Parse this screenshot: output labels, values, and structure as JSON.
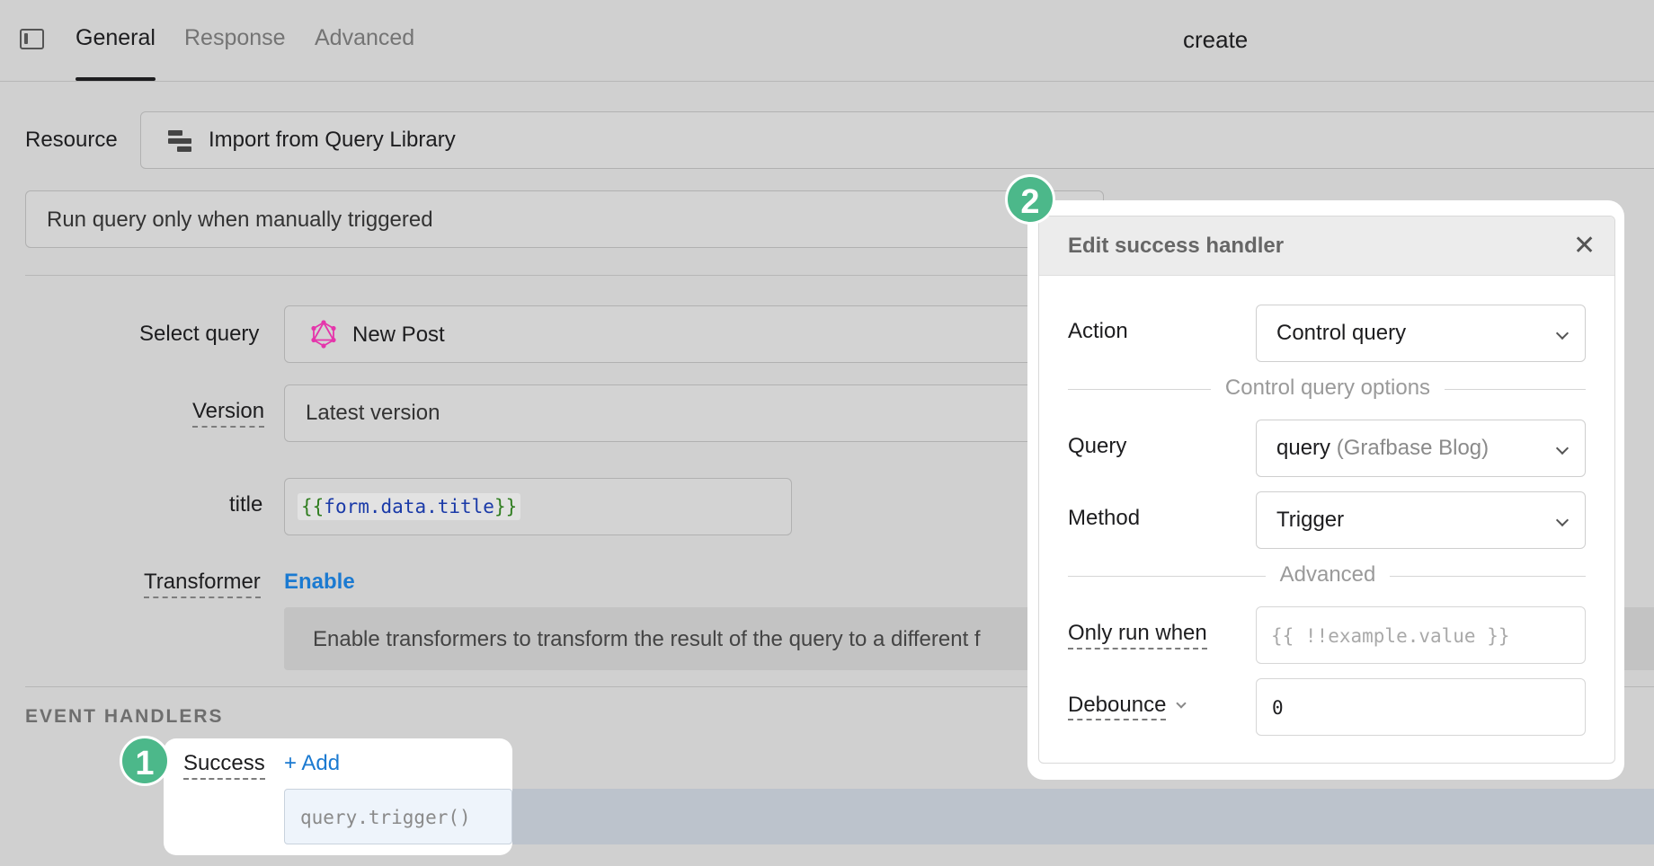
{
  "tabs": [
    {
      "label": "General"
    },
    {
      "label": "Response"
    },
    {
      "label": "Advanced"
    }
  ],
  "page_title": "create",
  "resource": {
    "label": "Resource",
    "value": "Import from Query Library"
  },
  "run_mode": {
    "value": "Run query only when manually triggered"
  },
  "select_query": {
    "label": "Select query",
    "value": "New Post"
  },
  "version": {
    "label": "Version",
    "value": "Latest version"
  },
  "title_field": {
    "label": "title",
    "value": "{{form.data.title}}"
  },
  "transformer": {
    "label": "Transformer",
    "enable_link": "Enable",
    "info": "Enable transformers to transform the result of the query to a different f"
  },
  "event_handlers": {
    "heading": "EVENT HANDLERS",
    "success_label": "Success",
    "add_label": "+ Add",
    "handler_item": "query.trigger()"
  },
  "badges": {
    "one": "1",
    "two": "2"
  },
  "popover": {
    "title": "Edit success handler",
    "action": {
      "label": "Action",
      "value": "Control query"
    },
    "section1": "Control query options",
    "query": {
      "label": "Query",
      "value": "query",
      "sub": "(Grafbase Blog)"
    },
    "method": {
      "label": "Method",
      "value": "Trigger"
    },
    "section2": "Advanced",
    "only_run_when": {
      "label": "Only run when",
      "placeholder": "{{ !!example.value }}"
    },
    "debounce": {
      "label": "Debounce",
      "value": "0"
    }
  },
  "colors": {
    "accent_link": "#1b7ad1",
    "badge": "#4cb88a",
    "code_green": "#2f7d1f",
    "code_blue": "#1a3aa8",
    "graphql_pink": "#e535ab"
  }
}
